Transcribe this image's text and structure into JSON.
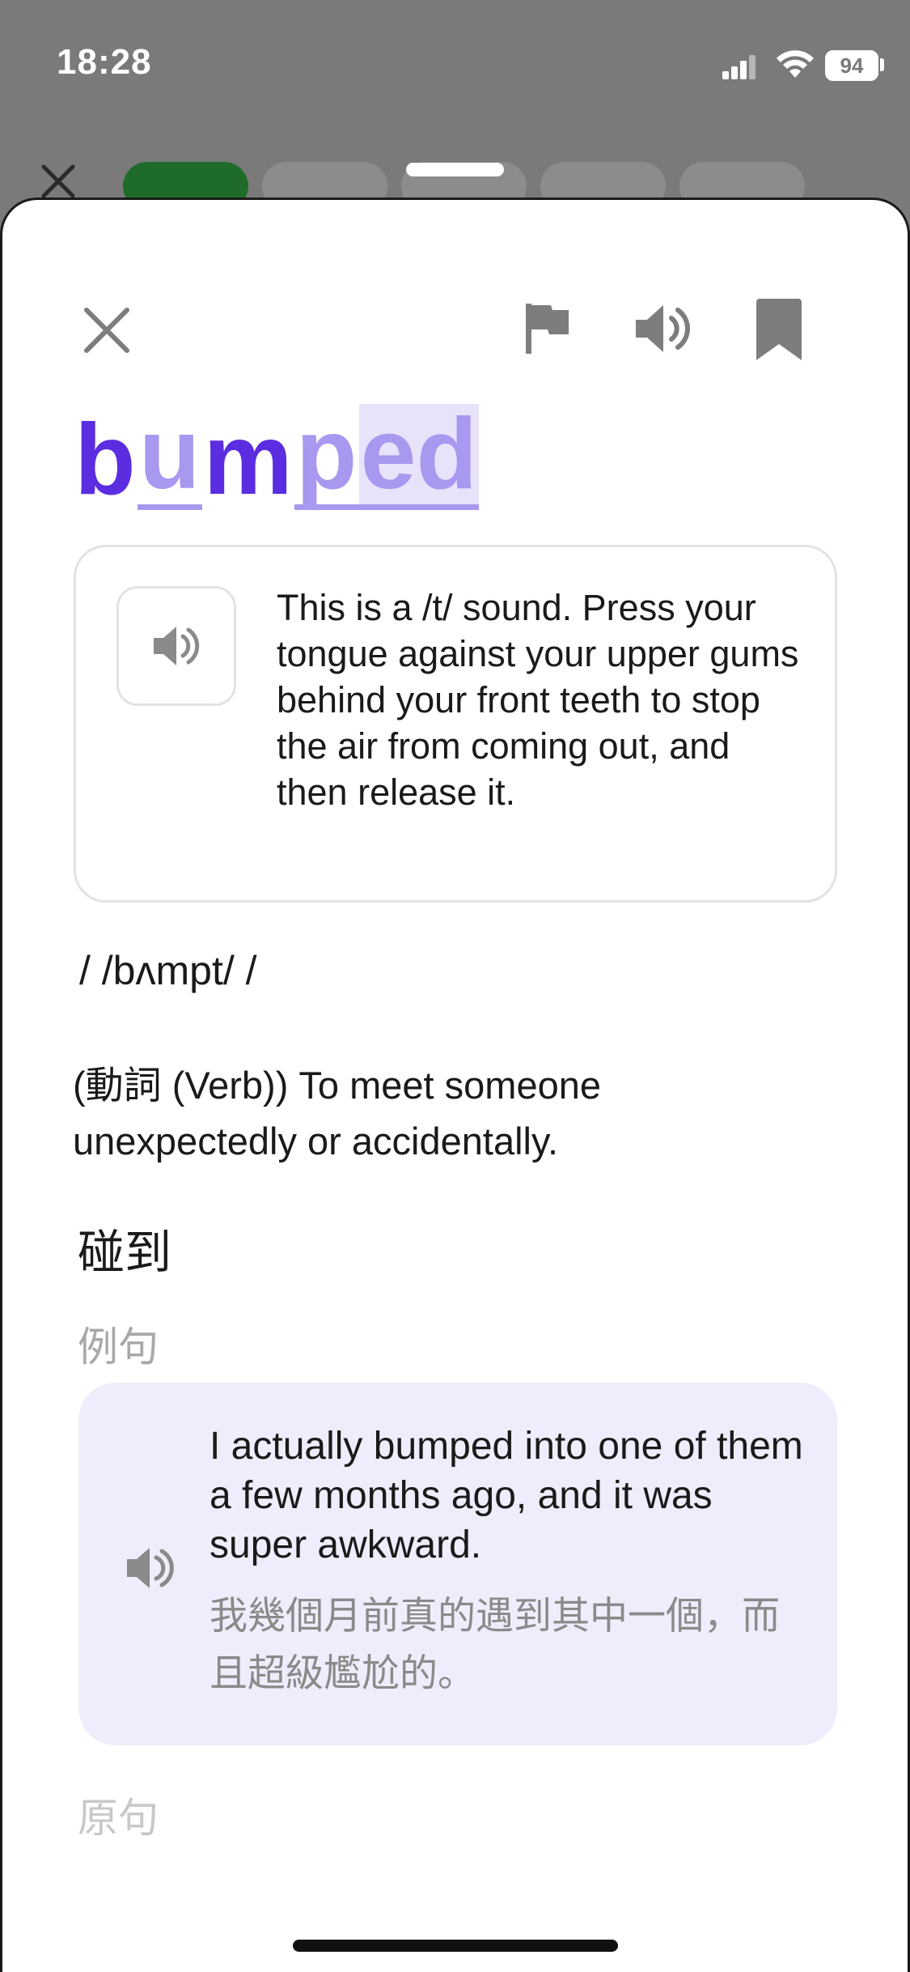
{
  "status_bar": {
    "time": "18:28",
    "battery": "94"
  },
  "word": {
    "segments": [
      {
        "text": "b",
        "style": "dark"
      },
      {
        "text": "u",
        "style": "light"
      },
      {
        "text": "m",
        "style": "dark"
      },
      {
        "text": "p",
        "style": "light"
      },
      {
        "text": "ed",
        "style": "highlight"
      }
    ]
  },
  "pronunciation_tip": "This is a /t/ sound. Press your tongue against your upper gums behind your front teeth to stop the air from coming out, and then release it.",
  "ipa": "/ /bʌmpt/ /",
  "definition": "(動詞 (Verb)) To meet someone unexpectedly or accidentally.",
  "translation": "碰到",
  "example_label": "例句",
  "example": {
    "english": "I actually bumped into one of them a few months ago, and it was super awkward.",
    "chinese": "我幾個月前真的遇到其中一個，而且超級尷尬的。"
  },
  "original_label": "原句",
  "colors": {
    "accent_dark": "#5b2de0",
    "accent_light": "#a898f0",
    "highlight_bg": "#e7e3fb",
    "example_bg": "#eeedfb",
    "progress_done": "#1f6b2a"
  }
}
